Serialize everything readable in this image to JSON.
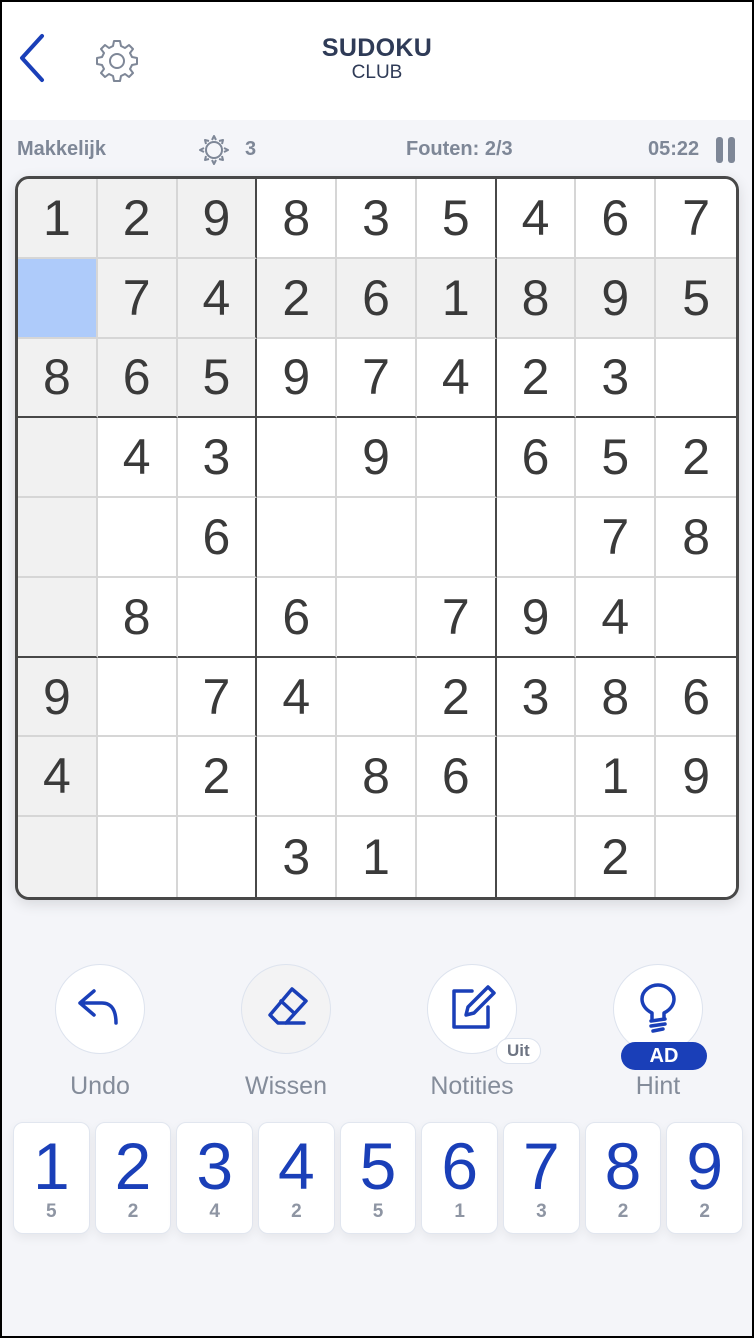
{
  "header": {
    "title": "SUDOKU",
    "subtitle": "CLUB",
    "back_icon": "chevron-left-icon",
    "settings_icon": "gear-icon"
  },
  "status": {
    "difficulty": "Makkelijk",
    "score_icon": "sun-icon",
    "score": "3",
    "mistakes": "Fouten: 2/3",
    "timer": "05:22",
    "pause_icon": "pause-icon"
  },
  "board": {
    "selected": {
      "row": 2,
      "col": 1
    },
    "rows": [
      [
        "1",
        "2",
        "9",
        "8",
        "3",
        "5",
        "4",
        "6",
        "7"
      ],
      [
        "",
        "7",
        "4",
        "2",
        "6",
        "1",
        "8",
        "9",
        "5"
      ],
      [
        "8",
        "6",
        "5",
        "9",
        "7",
        "4",
        "2",
        "3",
        ""
      ],
      [
        "",
        "4",
        "3",
        "",
        "9",
        "",
        "6",
        "5",
        "2"
      ],
      [
        "",
        "",
        "6",
        "",
        "",
        "",
        "",
        "7",
        "8"
      ],
      [
        "",
        "8",
        "",
        "6",
        "",
        "7",
        "9",
        "4",
        ""
      ],
      [
        "9",
        "",
        "7",
        "4",
        "",
        "2",
        "3",
        "8",
        "6"
      ],
      [
        "4",
        "",
        "2",
        "",
        "8",
        "6",
        "",
        "1",
        "9"
      ],
      [
        "",
        "",
        "",
        "3",
        "1",
        "",
        "",
        "2",
        ""
      ]
    ]
  },
  "actions": [
    {
      "label": "Undo",
      "icon": "undo-icon"
    },
    {
      "label": "Wissen",
      "icon": "eraser-icon"
    },
    {
      "label": "Notities",
      "icon": "pencil-note-icon",
      "badge": "Uit"
    },
    {
      "label": "Hint",
      "icon": "lightbulb-icon",
      "badge": "AD"
    }
  ],
  "numpad": [
    {
      "digit": "1",
      "remaining": "5"
    },
    {
      "digit": "2",
      "remaining": "2"
    },
    {
      "digit": "3",
      "remaining": "4"
    },
    {
      "digit": "4",
      "remaining": "2"
    },
    {
      "digit": "5",
      "remaining": "5"
    },
    {
      "digit": "6",
      "remaining": "1"
    },
    {
      "digit": "7",
      "remaining": "3"
    },
    {
      "digit": "8",
      "remaining": "2"
    },
    {
      "digit": "9",
      "remaining": "2"
    }
  ],
  "colors": {
    "accent": "#1a3fb8",
    "selected_cell": "#aecbfa",
    "highlight_cell": "#f1f1f1",
    "muted_text": "#7e8797"
  }
}
